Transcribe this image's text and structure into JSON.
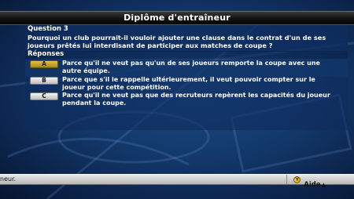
{
  "title": "Diplôme d'entraîneur",
  "question": {
    "label": "Question 3",
    "text": "Pourquoi un club pourrait-il vouloir ajouter une clause dans le contrat d'un de ses joueurs prêtés lui interdisant de participer aux matches de coupe ?"
  },
  "answers_header": "Réponses",
  "answers": [
    {
      "key": "A",
      "text": "Parce qu'il ne veut pas qu'un de ses joueurs remporte la coupe avec une autre équipe.",
      "selected": true
    },
    {
      "key": "B",
      "text": "Parce que s'il le rappelle ultérieurement, il veut pouvoir compter sur le joueur pour cette compétition.",
      "selected": false
    },
    {
      "key": "C",
      "text": "Parce qu'il ne veut pas que des recruteurs repèrent les capacités du joueur pendant la coupe.",
      "selected": false
    }
  ],
  "bottom_bar": {
    "status": "neur.",
    "help_label": "Aide",
    "help_icon": "yellow-y-button-icon"
  },
  "colors": {
    "background": "#12386a",
    "selected_button": "#c9a52a",
    "title_bar": "#121212",
    "bottom_bar": "#d0d0d0"
  }
}
